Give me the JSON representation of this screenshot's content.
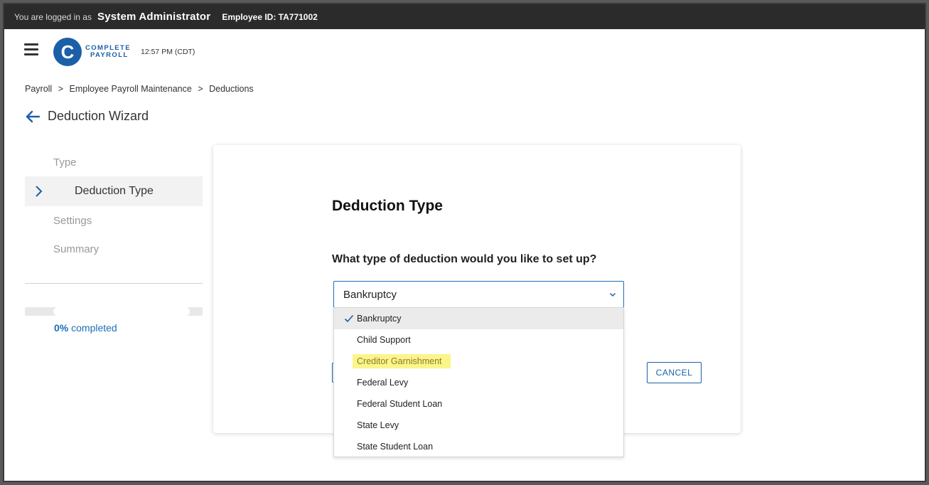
{
  "topbar": {
    "logged_in_label": "You are logged in as",
    "user_name": "System Administrator",
    "employee_id": "Employee ID: TA771002"
  },
  "header": {
    "logo_letter": "C",
    "logo_line1": "COMPLETE",
    "logo_line2": "PAYROLL",
    "time": "12:57 PM (CDT)"
  },
  "breadcrumb": {
    "items": [
      "Payroll",
      "Employee Payroll Maintenance",
      "Deductions"
    ],
    "separator": ">"
  },
  "page": {
    "title": "Deduction Wizard"
  },
  "wizard": {
    "steps": [
      {
        "label": "Type"
      },
      {
        "label": "Deduction Type"
      },
      {
        "label": "Settings"
      },
      {
        "label": "Summary"
      }
    ],
    "progress_value": "0%",
    "progress_label": "completed",
    "progress_fraction": 0
  },
  "card": {
    "title": "Deduction Type",
    "question": "What type of deduction would you like to set up?",
    "cancel_label": "CANCEL"
  },
  "select": {
    "value": "Bankruptcy",
    "options": [
      "Bankruptcy",
      "Child Support",
      "Creditor Garnishment",
      "Federal Levy",
      "Federal Student Loan",
      "State Levy",
      "State Student Loan"
    ]
  },
  "colors": {
    "brand": "#1b5fa8",
    "topbar": "#2b2b2b",
    "highlight": "#fbf58a"
  }
}
